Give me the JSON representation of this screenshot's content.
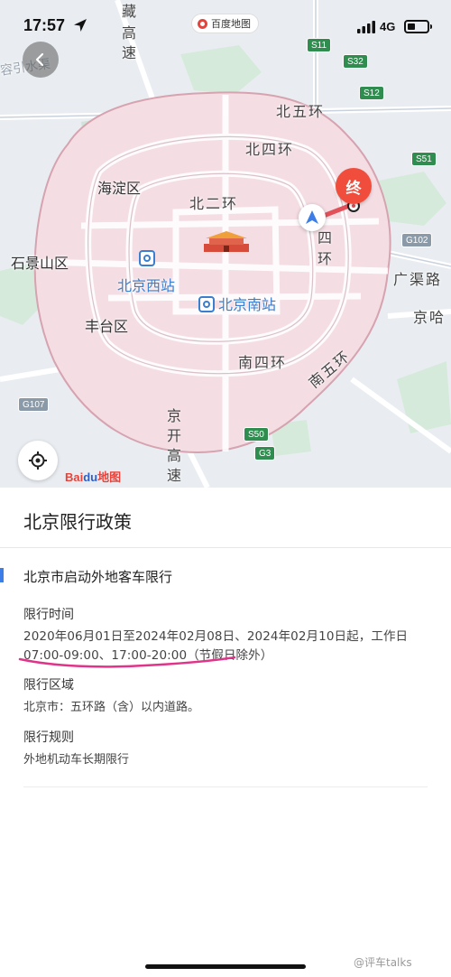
{
  "status_bar": {
    "time": "17:57",
    "network": "4G",
    "app_name": "百度地图"
  },
  "map": {
    "districts": [
      "海淀区",
      "石景山区",
      "丰台区"
    ],
    "stations": [
      "北京西站",
      "北京南站"
    ],
    "ring_roads": [
      "北五环",
      "北四环",
      "北二环",
      "四",
      "环",
      "南四环",
      "南五环",
      "广渠路",
      "京哈"
    ],
    "vertical_roads": [
      "藏",
      "高",
      "速",
      "京",
      "开",
      "高",
      "速"
    ],
    "shields": [
      "S11",
      "S32",
      "S12",
      "S51",
      "G102",
      "G107",
      "S50",
      "G3"
    ],
    "end_marker": "终",
    "logo_a": "Bai",
    "logo_b": "du",
    "logo_c": "地图",
    "corner_text": "容引水渠"
  },
  "panel": {
    "title": "北京限行政策",
    "section_title": "北京市启动外地客车限行",
    "time_label": "限行时间",
    "time_value": "2020年06月01日至2024年02月08日、2024年02月10日起，工作日07:00-09:00、17:00-20:00（节假日除外）",
    "area_label": "限行区域",
    "area_value": "北京市：五环路（含）以内道路。",
    "rule_label": "限行规则",
    "rule_value": "外地机动车长期限行"
  },
  "watermark": "@评车talks",
  "colors": {
    "accent": "#3d7de8",
    "end_marker": "#f04d3c",
    "restricted_area": "#f4dde3",
    "pen_underline": "#e0348a"
  }
}
